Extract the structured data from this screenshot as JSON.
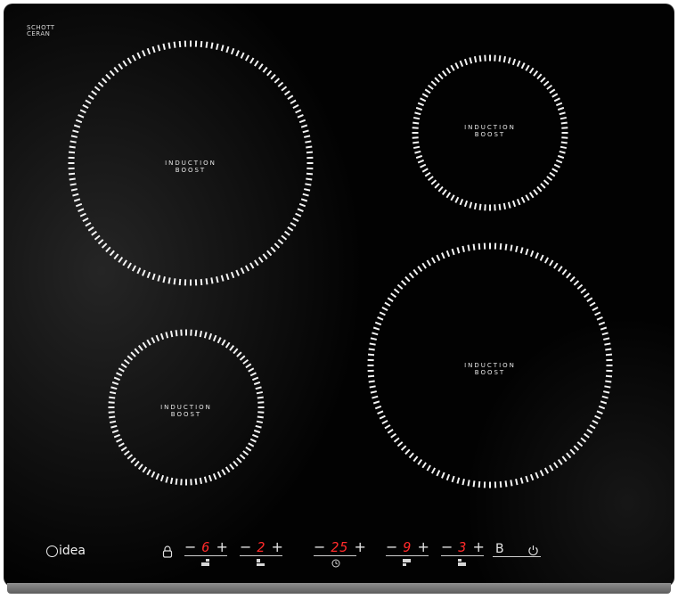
{
  "glass_mark": {
    "line1": "SCHOTT",
    "line2": "CERAN"
  },
  "brand": {
    "name": "idea",
    "prefix_icon": "midea-m-logo"
  },
  "zones": [
    {
      "id": "front-left-large",
      "line1": "INDUCTION",
      "line2": "BOOST"
    },
    {
      "id": "rear-right-small",
      "line1": "INDUCTION",
      "line2": "BOOST"
    },
    {
      "id": "front-left-small",
      "line1": "INDUCTION",
      "line2": "BOOST"
    },
    {
      "id": "front-right-large",
      "line1": "INDUCTION",
      "line2": "BOOST"
    }
  ],
  "controls": {
    "minus": "−",
    "plus": "+",
    "zone1_level": "6",
    "zone2_level": "2",
    "timer_value": "25",
    "zone3_level": "9",
    "zone4_level": "3",
    "boost_label": "B"
  },
  "colors": {
    "glass": "#020202",
    "display": "#ff2a2a",
    "print": "#e8e8e8"
  }
}
